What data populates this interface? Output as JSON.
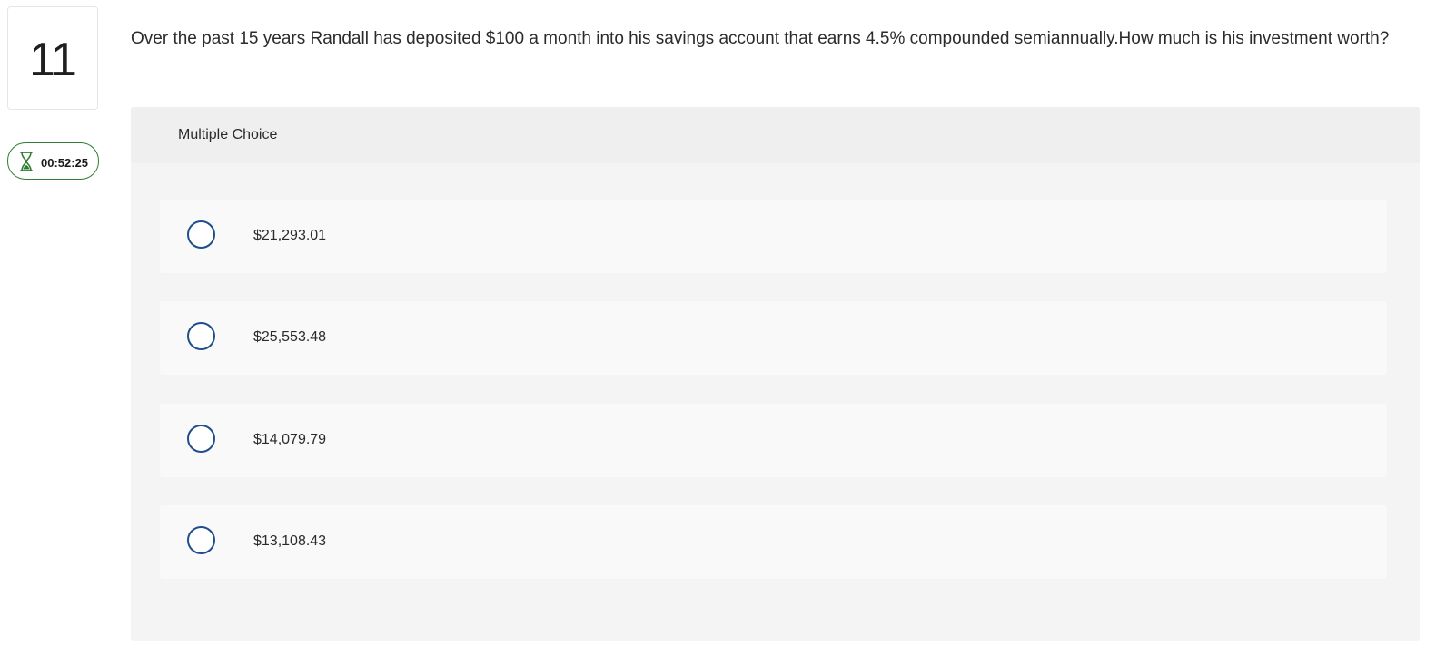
{
  "question": {
    "number": "11",
    "text": "Over the past 15 years Randall has deposited $100 a month into his savings account that earns 4.5% compounded semiannually.How much is his investment worth?"
  },
  "timer": {
    "icon": "hourglass-icon",
    "value": "00:52:25",
    "color": "#2e7d32"
  },
  "answer_panel": {
    "header_label": "Multiple Choice",
    "choices": [
      {
        "label": "$21,293.01"
      },
      {
        "label": "$25,553.48"
      },
      {
        "label": "$14,079.79"
      },
      {
        "label": "$13,108.43"
      }
    ]
  },
  "colors": {
    "radio_border": "#1f4e8c",
    "panel_background": "#f4f4f4"
  }
}
